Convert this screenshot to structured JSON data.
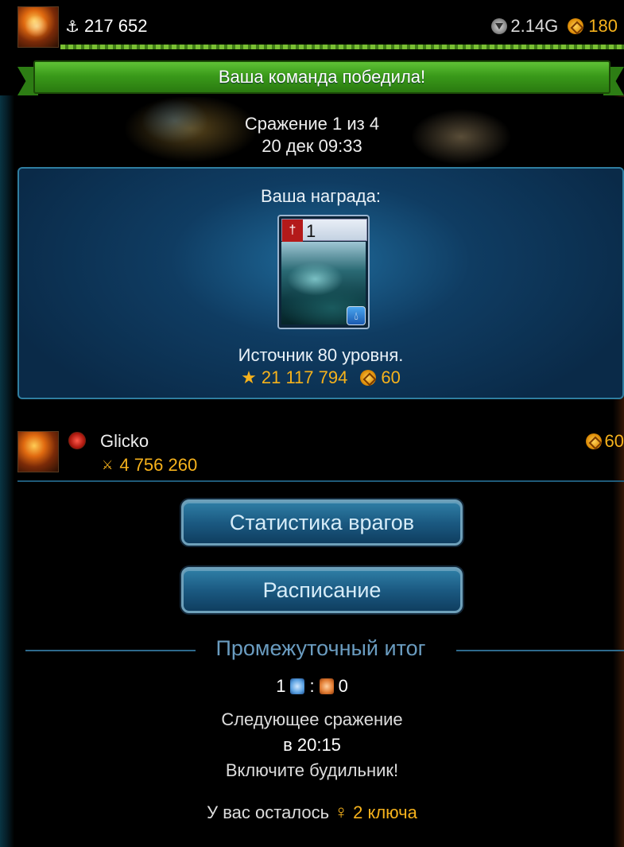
{
  "header": {
    "power": "217 652",
    "silver": "2.14G",
    "gold": "180"
  },
  "banner": {
    "text": "Ваша команда победила!"
  },
  "battle": {
    "title": "Сражение 1 из 4",
    "date": "20 дек 09:33"
  },
  "reward": {
    "title": "Ваша награда:",
    "card_count": "1",
    "name": "Источник 80 уровня.",
    "stars": "21 117 794",
    "coins": "60"
  },
  "player": {
    "name": "Glicko",
    "power": "4 756 260",
    "coins": "60"
  },
  "buttons": {
    "enemy_stats": "Статистика врагов",
    "schedule": "Расписание"
  },
  "interim": {
    "title": "Промежуточный итог",
    "score_a": "1",
    "separator": ":",
    "score_b": "0",
    "next_label": "Следующее сражение",
    "next_time": "в 20:15",
    "alarm": "Включите будильник!",
    "keys_prefix": "У вас осталось",
    "keys_count": "2 ключа"
  },
  "icons": {
    "power": "sword-icon",
    "silver": "gem-icon",
    "gold": "coin-icon",
    "star": "star-icon",
    "key": "key-icon"
  },
  "colors": {
    "gold": "#f6b21c",
    "banner_green": "#3a9a1a",
    "panel_blue": "#0f3c62",
    "button_blue": "#1b5a82"
  }
}
